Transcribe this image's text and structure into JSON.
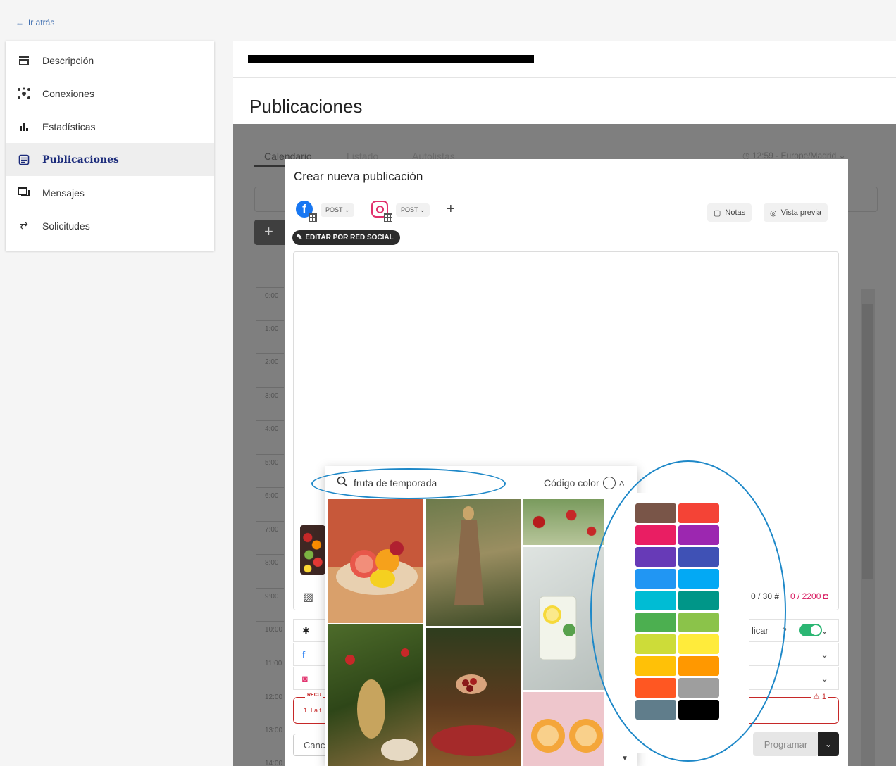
{
  "nav": {
    "back_label": "Ir atrás"
  },
  "sidebar": {
    "items": [
      {
        "label": "Descripción",
        "icon": "store-icon"
      },
      {
        "label": "Conexiones",
        "icon": "hub-icon"
      },
      {
        "label": "Estadísticas",
        "icon": "bar-chart-icon"
      },
      {
        "label": "Publicaciones",
        "icon": "article-icon",
        "active": true
      },
      {
        "label": "Mensajes",
        "icon": "chat-icon"
      },
      {
        "label": "Solicitudes",
        "icon": "swap-icon"
      }
    ]
  },
  "page": {
    "title": "Publicaciones"
  },
  "background": {
    "tabs": [
      "Calendario",
      "Listado",
      "Autolistas"
    ],
    "timezone": "12:59 - Europe/Madrid",
    "hours": [
      "0:00",
      "1:00",
      "2:00",
      "3:00",
      "4:00",
      "5:00",
      "6:00",
      "7:00",
      "8:00",
      "9:00",
      "10:00",
      "11:00",
      "12:00",
      "13:00",
      "14:00"
    ]
  },
  "modal": {
    "title": "Crear nueva publicación",
    "post_type": "POST",
    "notes_label": "Notas",
    "preview_label": "Vista previa",
    "edit_by_network_label": "EDITAR POR RED SOCIAL",
    "hashtag_counter": "0 / 30",
    "char_counter": "0 / 2200",
    "publish_label": "licar",
    "warning": {
      "title": "RECU",
      "text": "1. La f",
      "count": "1"
    },
    "cancel_label": "Canc",
    "schedule_label": "Programar"
  },
  "image_picker": {
    "search_value": "fruta de temporada",
    "color_code_label": "Código color"
  },
  "color_palette": [
    "#795548",
    "#f44336",
    "#e91e63",
    "#9c27b0",
    "#673ab7",
    "#3f51b5",
    "#2196f3",
    "#03a9f4",
    "#00bcd4",
    "#009688",
    "#4caf50",
    "#8bc34a",
    "#cddc39",
    "#ffeb3b",
    "#ffc107",
    "#ff9800",
    "#ff5722",
    "#9e9e9e",
    "#607d8b",
    "#000000"
  ],
  "colors": {
    "accent": "#1e88c8",
    "publicar_toggle": "#2bb673",
    "warning": "#c62828"
  }
}
